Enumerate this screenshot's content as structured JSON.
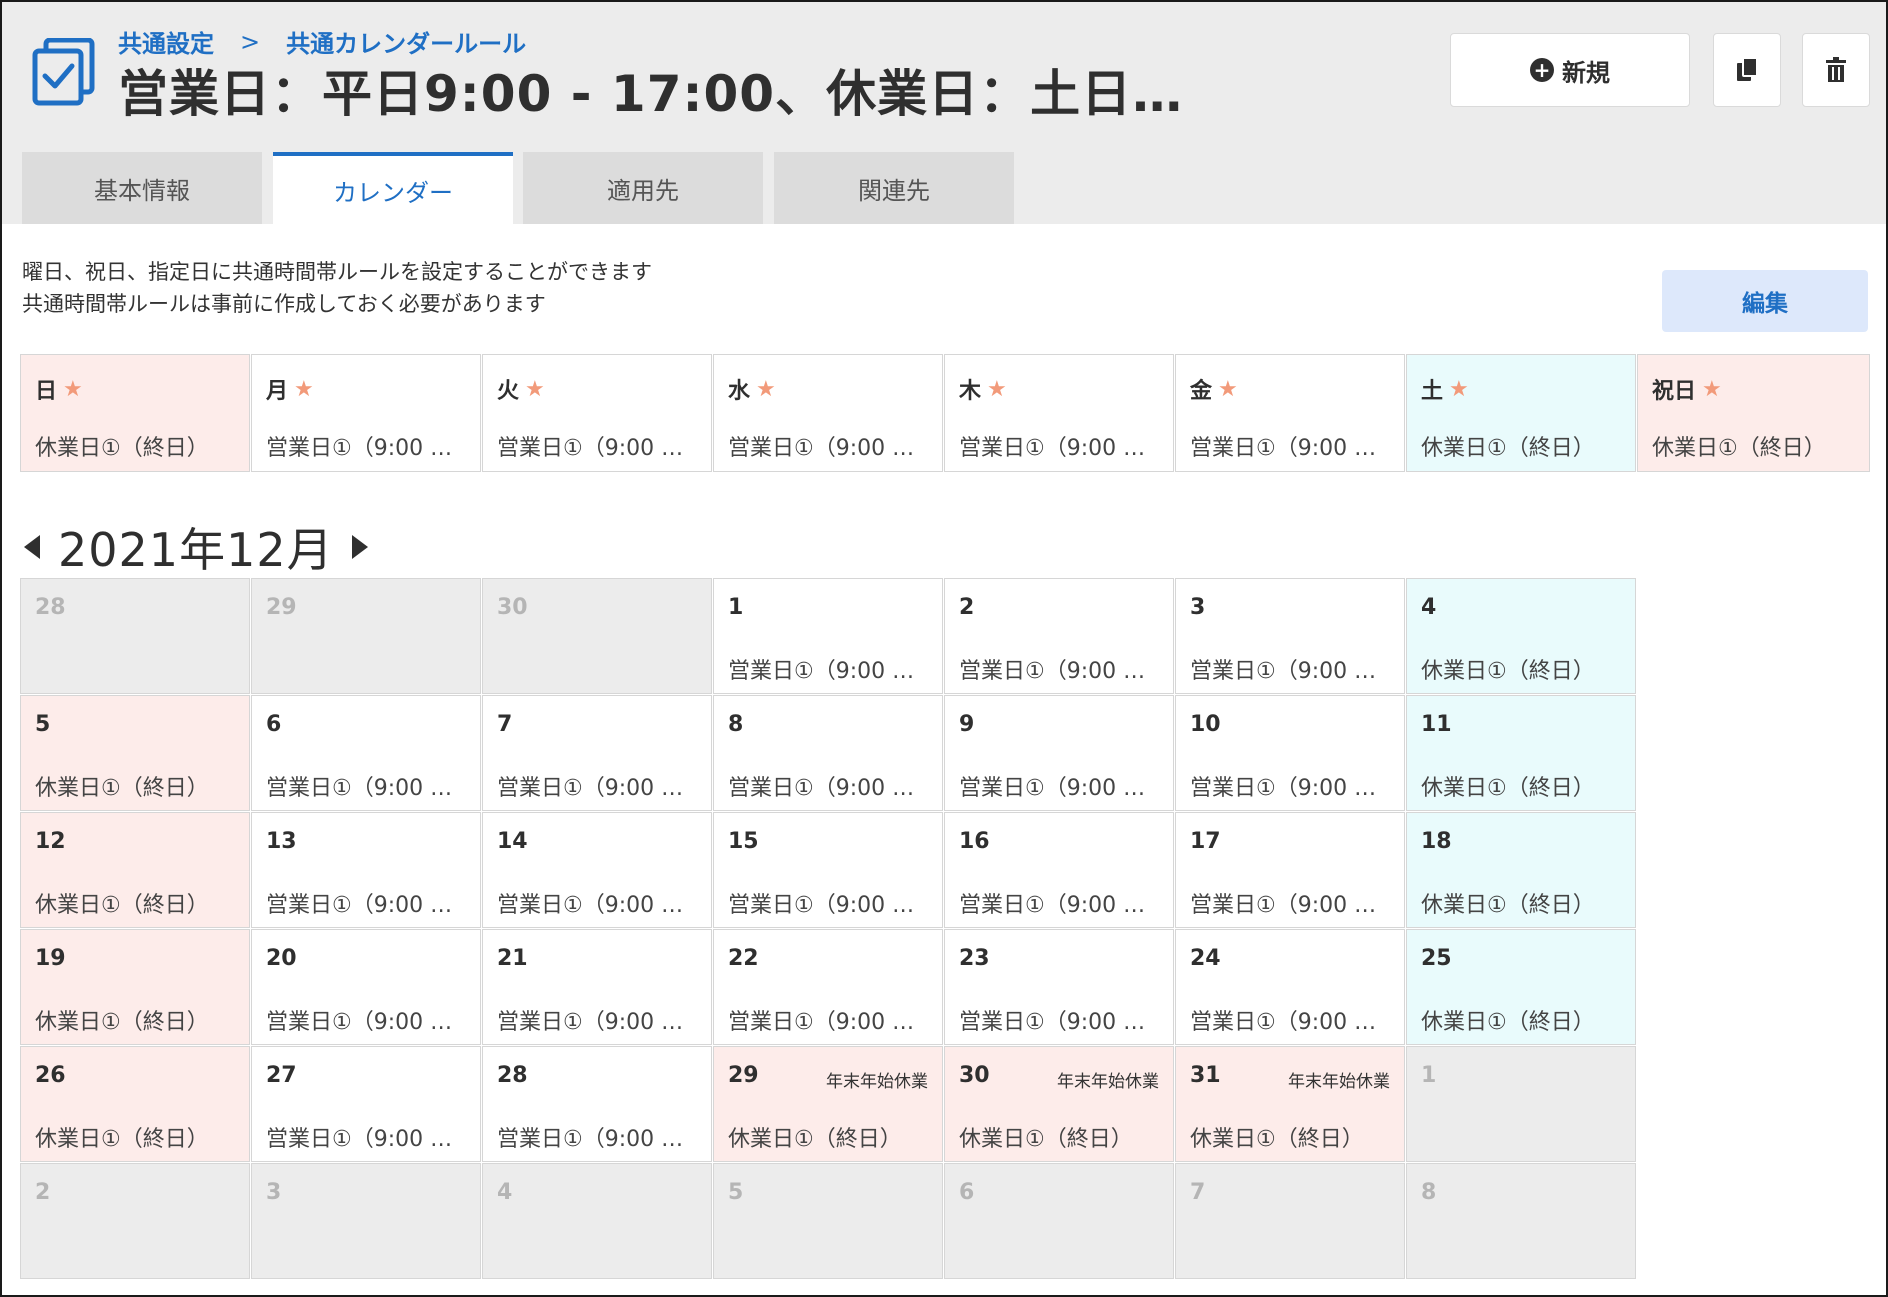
{
  "header": {
    "breadcrumb": [
      "共通設定",
      "共通カレンダールール"
    ],
    "breadcrumb_separator": ">",
    "title": "営業日：平日9:00 - 17:00、休業日：土日…",
    "new_button": "新規",
    "copy_icon": "copy-icon",
    "trash_icon": "trash-icon",
    "app_icon": "checkbox-icon"
  },
  "tabs": [
    {
      "label": "基本情報",
      "active": false
    },
    {
      "label": "カレンダー",
      "active": true
    },
    {
      "label": "適用先",
      "active": false
    },
    {
      "label": "関連先",
      "active": false
    }
  ],
  "description": {
    "line1": "曜日、祝日、指定日に共通時間帯ルールを設定することができます",
    "line2": "共通時間帯ルールは事前に作成しておく必要があります"
  },
  "edit_button": "編集",
  "weekday_rules": [
    {
      "day": "日",
      "value": "休業日①（終日）",
      "bg": "pink"
    },
    {
      "day": "月",
      "value": "営業日①（9:00 …",
      "bg": "white"
    },
    {
      "day": "火",
      "value": "営業日①（9:00 …",
      "bg": "white"
    },
    {
      "day": "水",
      "value": "営業日①（9:00 …",
      "bg": "white"
    },
    {
      "day": "木",
      "value": "営業日①（9:00 …",
      "bg": "white"
    },
    {
      "day": "金",
      "value": "営業日①（9:00 …",
      "bg": "white"
    },
    {
      "day": "土",
      "value": "休業日①（終日）",
      "bg": "cyan"
    },
    {
      "day": "祝日",
      "value": "休業日①（終日）",
      "bg": "pink"
    }
  ],
  "month_label": "2021年12月",
  "calendar": [
    {
      "date": "28",
      "value": "",
      "note": "",
      "bg": "grey",
      "dim": true
    },
    {
      "date": "29",
      "value": "",
      "note": "",
      "bg": "grey",
      "dim": true
    },
    {
      "date": "30",
      "value": "",
      "note": "",
      "bg": "grey",
      "dim": true
    },
    {
      "date": "1",
      "value": "営業日①（9:00 …",
      "note": "",
      "bg": "white",
      "dim": false
    },
    {
      "date": "2",
      "value": "営業日①（9:00 …",
      "note": "",
      "bg": "white",
      "dim": false
    },
    {
      "date": "3",
      "value": "営業日①（9:00 …",
      "note": "",
      "bg": "white",
      "dim": false
    },
    {
      "date": "4",
      "value": "休業日①（終日）",
      "note": "",
      "bg": "cyan",
      "dim": false
    },
    {
      "date": "5",
      "value": "休業日①（終日）",
      "note": "",
      "bg": "pink",
      "dim": false
    },
    {
      "date": "6",
      "value": "営業日①（9:00 …",
      "note": "",
      "bg": "white",
      "dim": false
    },
    {
      "date": "7",
      "value": "営業日①（9:00 …",
      "note": "",
      "bg": "white",
      "dim": false
    },
    {
      "date": "8",
      "value": "営業日①（9:00 …",
      "note": "",
      "bg": "white",
      "dim": false
    },
    {
      "date": "9",
      "value": "営業日①（9:00 …",
      "note": "",
      "bg": "white",
      "dim": false
    },
    {
      "date": "10",
      "value": "営業日①（9:00 …",
      "note": "",
      "bg": "white",
      "dim": false
    },
    {
      "date": "11",
      "value": "休業日①（終日）",
      "note": "",
      "bg": "cyan",
      "dim": false
    },
    {
      "date": "12",
      "value": "休業日①（終日）",
      "note": "",
      "bg": "pink",
      "dim": false
    },
    {
      "date": "13",
      "value": "営業日①（9:00 …",
      "note": "",
      "bg": "white",
      "dim": false
    },
    {
      "date": "14",
      "value": "営業日①（9:00 …",
      "note": "",
      "bg": "white",
      "dim": false
    },
    {
      "date": "15",
      "value": "営業日①（9:00 …",
      "note": "",
      "bg": "white",
      "dim": false
    },
    {
      "date": "16",
      "value": "営業日①（9:00 …",
      "note": "",
      "bg": "white",
      "dim": false
    },
    {
      "date": "17",
      "value": "営業日①（9:00 …",
      "note": "",
      "bg": "white",
      "dim": false
    },
    {
      "date": "18",
      "value": "休業日①（終日）",
      "note": "",
      "bg": "cyan",
      "dim": false
    },
    {
      "date": "19",
      "value": "休業日①（終日）",
      "note": "",
      "bg": "pink",
      "dim": false
    },
    {
      "date": "20",
      "value": "営業日①（9:00 …",
      "note": "",
      "bg": "white",
      "dim": false
    },
    {
      "date": "21",
      "value": "営業日①（9:00 …",
      "note": "",
      "bg": "white",
      "dim": false
    },
    {
      "date": "22",
      "value": "営業日①（9:00 …",
      "note": "",
      "bg": "white",
      "dim": false
    },
    {
      "date": "23",
      "value": "営業日①（9:00 …",
      "note": "",
      "bg": "white",
      "dim": false
    },
    {
      "date": "24",
      "value": "営業日①（9:00 …",
      "note": "",
      "bg": "white",
      "dim": false
    },
    {
      "date": "25",
      "value": "休業日①（終日）",
      "note": "",
      "bg": "cyan",
      "dim": false
    },
    {
      "date": "26",
      "value": "休業日①（終日）",
      "note": "",
      "bg": "pink",
      "dim": false
    },
    {
      "date": "27",
      "value": "営業日①（9:00 …",
      "note": "",
      "bg": "white",
      "dim": false
    },
    {
      "date": "28",
      "value": "営業日①（9:00 …",
      "note": "",
      "bg": "white",
      "dim": false
    },
    {
      "date": "29",
      "value": "休業日①（終日）",
      "note": "年末年始休業",
      "bg": "pink",
      "dim": false
    },
    {
      "date": "30",
      "value": "休業日①（終日）",
      "note": "年末年始休業",
      "bg": "pink",
      "dim": false
    },
    {
      "date": "31",
      "value": "休業日①（終日）",
      "note": "年末年始休業",
      "bg": "pink",
      "dim": false
    },
    {
      "date": "1",
      "value": "",
      "note": "",
      "bg": "grey",
      "dim": true
    },
    {
      "date": "2",
      "value": "",
      "note": "",
      "bg": "grey",
      "dim": true
    },
    {
      "date": "3",
      "value": "",
      "note": "",
      "bg": "grey",
      "dim": true
    },
    {
      "date": "4",
      "value": "",
      "note": "",
      "bg": "grey",
      "dim": true
    },
    {
      "date": "5",
      "value": "",
      "note": "",
      "bg": "grey",
      "dim": true
    },
    {
      "date": "6",
      "value": "",
      "note": "",
      "bg": "grey",
      "dim": true
    },
    {
      "date": "7",
      "value": "",
      "note": "",
      "bg": "grey",
      "dim": true
    },
    {
      "date": "8",
      "value": "",
      "note": "",
      "bg": "grey",
      "dim": true
    }
  ],
  "colors": {
    "accent": "#1f6fc4",
    "pink": "#fdecea",
    "cyan": "#e9fbfc",
    "grey": "#ececec",
    "star": "#f29a7a"
  }
}
